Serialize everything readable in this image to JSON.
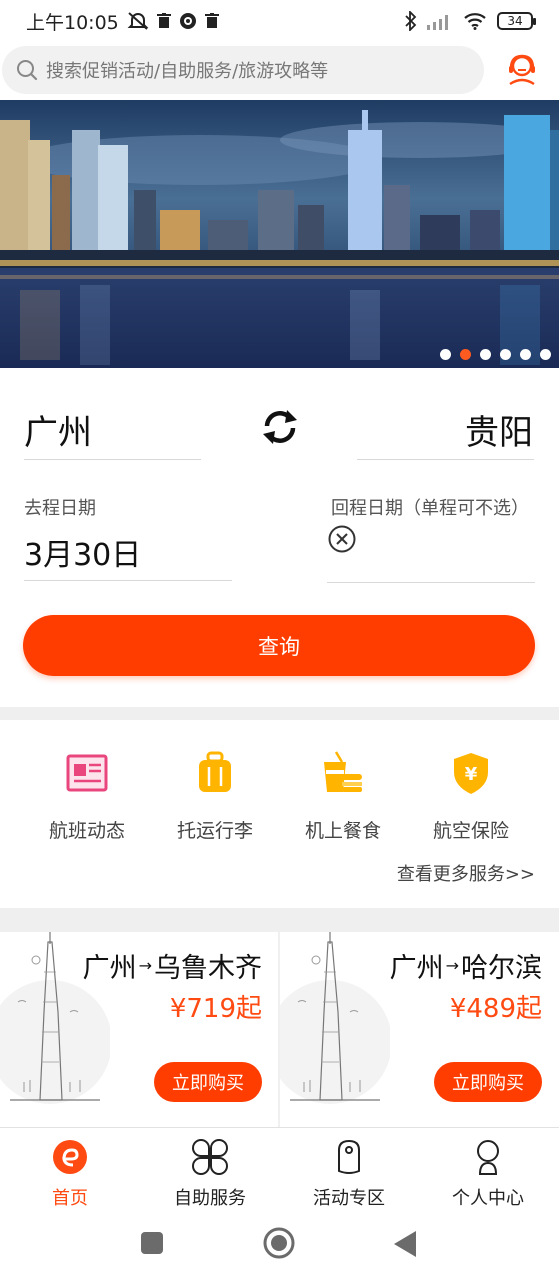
{
  "status_bar": {
    "time": "上午10:05",
    "battery": "34"
  },
  "search": {
    "placeholder": "搜索促销活动/自助服务/旅游攻略等"
  },
  "banner": {
    "slide_count": 6,
    "active_slide": 2
  },
  "booking": {
    "from_city": "广州",
    "to_city": "贵阳",
    "depart_label": "去程日期",
    "depart_date": "3月30日",
    "return_label": "回程日期（单程可不选）",
    "query_button": "查询"
  },
  "services": {
    "items": [
      {
        "label": "航班动态",
        "icon": "flight-status-icon",
        "color": "#e8467c"
      },
      {
        "label": "托运行李",
        "icon": "luggage-icon",
        "color": "#ffb400"
      },
      {
        "label": "机上餐食",
        "icon": "meal-icon",
        "color": "#ffb400"
      },
      {
        "label": "航空保险",
        "icon": "insurance-shield-icon",
        "color": "#ffb400"
      }
    ],
    "more_link": "查看更多服务>>"
  },
  "routes": [
    {
      "from": "广州",
      "arrow": "→",
      "to": "乌鲁木齐",
      "price": "¥719起",
      "button": "立即购买"
    },
    {
      "from": "广州",
      "arrow": "→",
      "to": "哈尔滨",
      "price": "¥489起",
      "button": "立即购买"
    }
  ],
  "bottom_nav": {
    "items": [
      {
        "label": "首页",
        "active": true
      },
      {
        "label": "自助服务",
        "active": false
      },
      {
        "label": "活动专区",
        "active": false
      },
      {
        "label": "个人中心",
        "active": false
      }
    ]
  },
  "colors": {
    "accent": "#ff3d00",
    "price": "#ff4a12"
  }
}
